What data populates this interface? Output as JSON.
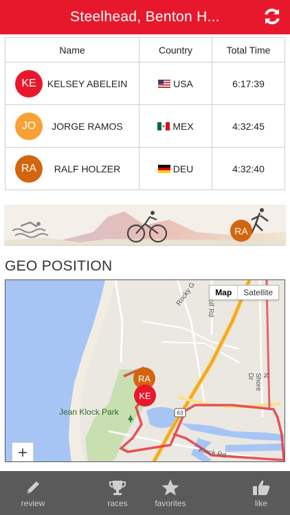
{
  "header": {
    "title": "Steelhead, Benton H..."
  },
  "table": {
    "columns": [
      "Name",
      "Country",
      "Total Time"
    ],
    "rows": [
      {
        "initials": "KE",
        "avatar_color": "#e8182c",
        "name": "KELSEY ABELEIN",
        "country": "USA",
        "time": "6:17:39"
      },
      {
        "initials": "JO",
        "avatar_color": "#f7a033",
        "name": "JORGE RAMOS",
        "country": "MEX",
        "time": "4:32:45"
      },
      {
        "initials": "RA",
        "avatar_color": "#d3650e",
        "name": "RALF HOLZER",
        "country": "DEU",
        "time": "4:32:40"
      }
    ]
  },
  "banner": {
    "marker_initials": "RA",
    "marker_color": "#d3650e"
  },
  "geo": {
    "title": "GEO POSITION"
  },
  "map": {
    "toggle": {
      "map_label": "Map",
      "satellite_label": "Satellite"
    },
    "labels": {
      "park": "Jean Klock Park",
      "rocky": "Rocky G",
      "golf": "Golf Rd",
      "shore": "N Shore Dr",
      "klock": "Klock Rd",
      "route": "63"
    },
    "markers": {
      "ra": "RA",
      "ke": "KE"
    },
    "zoom_label": "+"
  },
  "tabs": {
    "review": "review",
    "races": "races",
    "favorites": "favorites",
    "like": "like"
  }
}
